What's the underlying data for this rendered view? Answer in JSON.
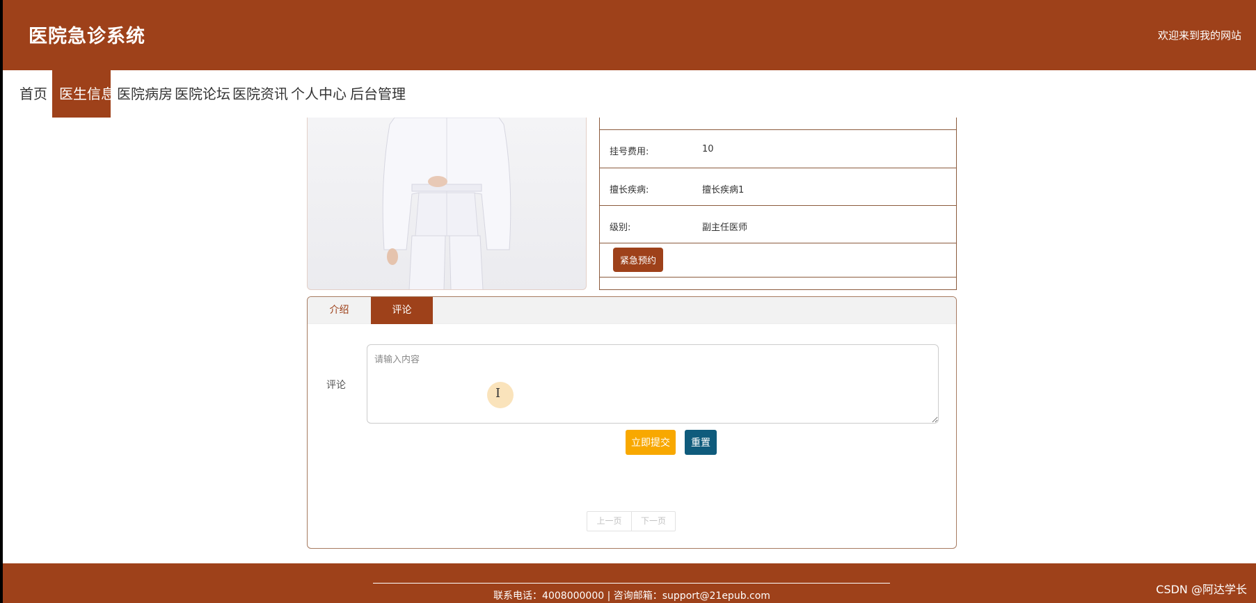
{
  "header": {
    "site_title": "医院急诊系统",
    "welcome": "欢迎来到我的网站"
  },
  "nav": {
    "items": [
      {
        "label": "首页",
        "active": false
      },
      {
        "label": "医生信息",
        "active": true
      },
      {
        "label": "医院病房",
        "active": false
      },
      {
        "label": "医院论坛",
        "active": false
      },
      {
        "label": "医院资讯",
        "active": false
      },
      {
        "label": "个人中心",
        "active": false
      },
      {
        "label": "后台管理",
        "active": false
      }
    ]
  },
  "doctor_info": {
    "rows": [
      {
        "label": "挂号费用:",
        "value": "10"
      },
      {
        "label": "擅长疾病:",
        "value": "擅长疾病1"
      },
      {
        "label": "级别:",
        "value": "副主任医师"
      }
    ],
    "book_button": "紧急预约"
  },
  "tabs": {
    "items": [
      {
        "label": "介绍",
        "active": false
      },
      {
        "label": "评论",
        "active": true
      }
    ]
  },
  "comment": {
    "label": "评论",
    "placeholder": "请输入内容",
    "value": "",
    "submit_label": "立即提交",
    "reset_label": "重置"
  },
  "pager": {
    "prev_label": "上一页",
    "next_label": "下一页"
  },
  "footer": {
    "text": "联系电话：4008000000 | 咨询邮箱：support@21epub.com"
  },
  "watermark": "CSDN @阿达学长",
  "colors": {
    "brand": "#9e411a",
    "submit": "#f8a800",
    "reset": "#0f5b7c"
  }
}
